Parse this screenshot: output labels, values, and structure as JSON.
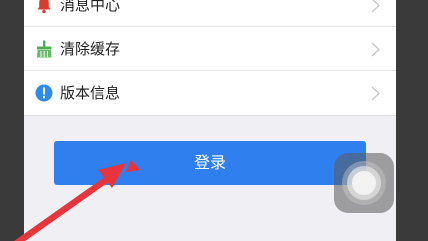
{
  "settings": {
    "items": [
      {
        "label": "消息中心",
        "icon": "bell-icon",
        "color": "#d93b2f"
      },
      {
        "label": "清除缓存",
        "icon": "broom-icon",
        "color": "#4caf50"
      },
      {
        "label": "版本信息",
        "icon": "info-icon",
        "color": "#2f8be8"
      }
    ]
  },
  "login": {
    "label": "登录",
    "color": "#2f80ee"
  },
  "annotation": {
    "arrow_color": "#e8343a"
  }
}
